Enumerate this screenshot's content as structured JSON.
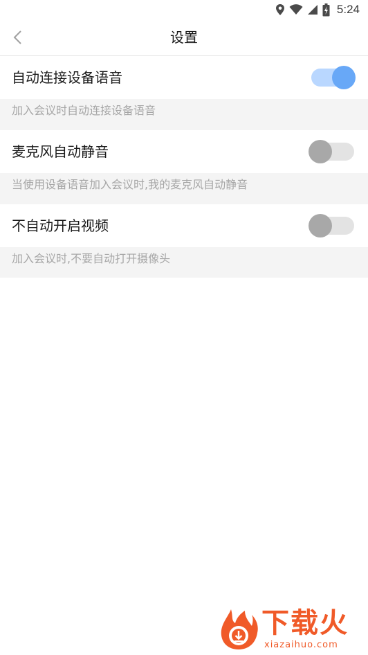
{
  "status_bar": {
    "time": "5:24",
    "icons": [
      "location-icon",
      "wifi-icon",
      "signal-icon",
      "battery-charging-icon"
    ]
  },
  "nav": {
    "title": "设置",
    "back_icon": "chevron-left-icon"
  },
  "settings": [
    {
      "label": "自动连接设备语音",
      "description": "加入会议时自动连接设备语音",
      "enabled": true
    },
    {
      "label": "麦克风自动静音",
      "description": "当使用设备语音加入会议时,我的麦克风自动静音",
      "enabled": false
    },
    {
      "label": "不自动开启视频",
      "description": "加入会议时,不要自动打开摄像头",
      "enabled": false
    }
  ],
  "watermark": {
    "title": "下载火",
    "url": "xiazaihuo.com"
  },
  "colors": {
    "switch_on_track": "#b9d7ff",
    "switch_on_thumb": "#68a8f7",
    "switch_off_track": "#e3e3e3",
    "switch_off_thumb": "#a8a8a8",
    "watermark": "#f05a28"
  }
}
